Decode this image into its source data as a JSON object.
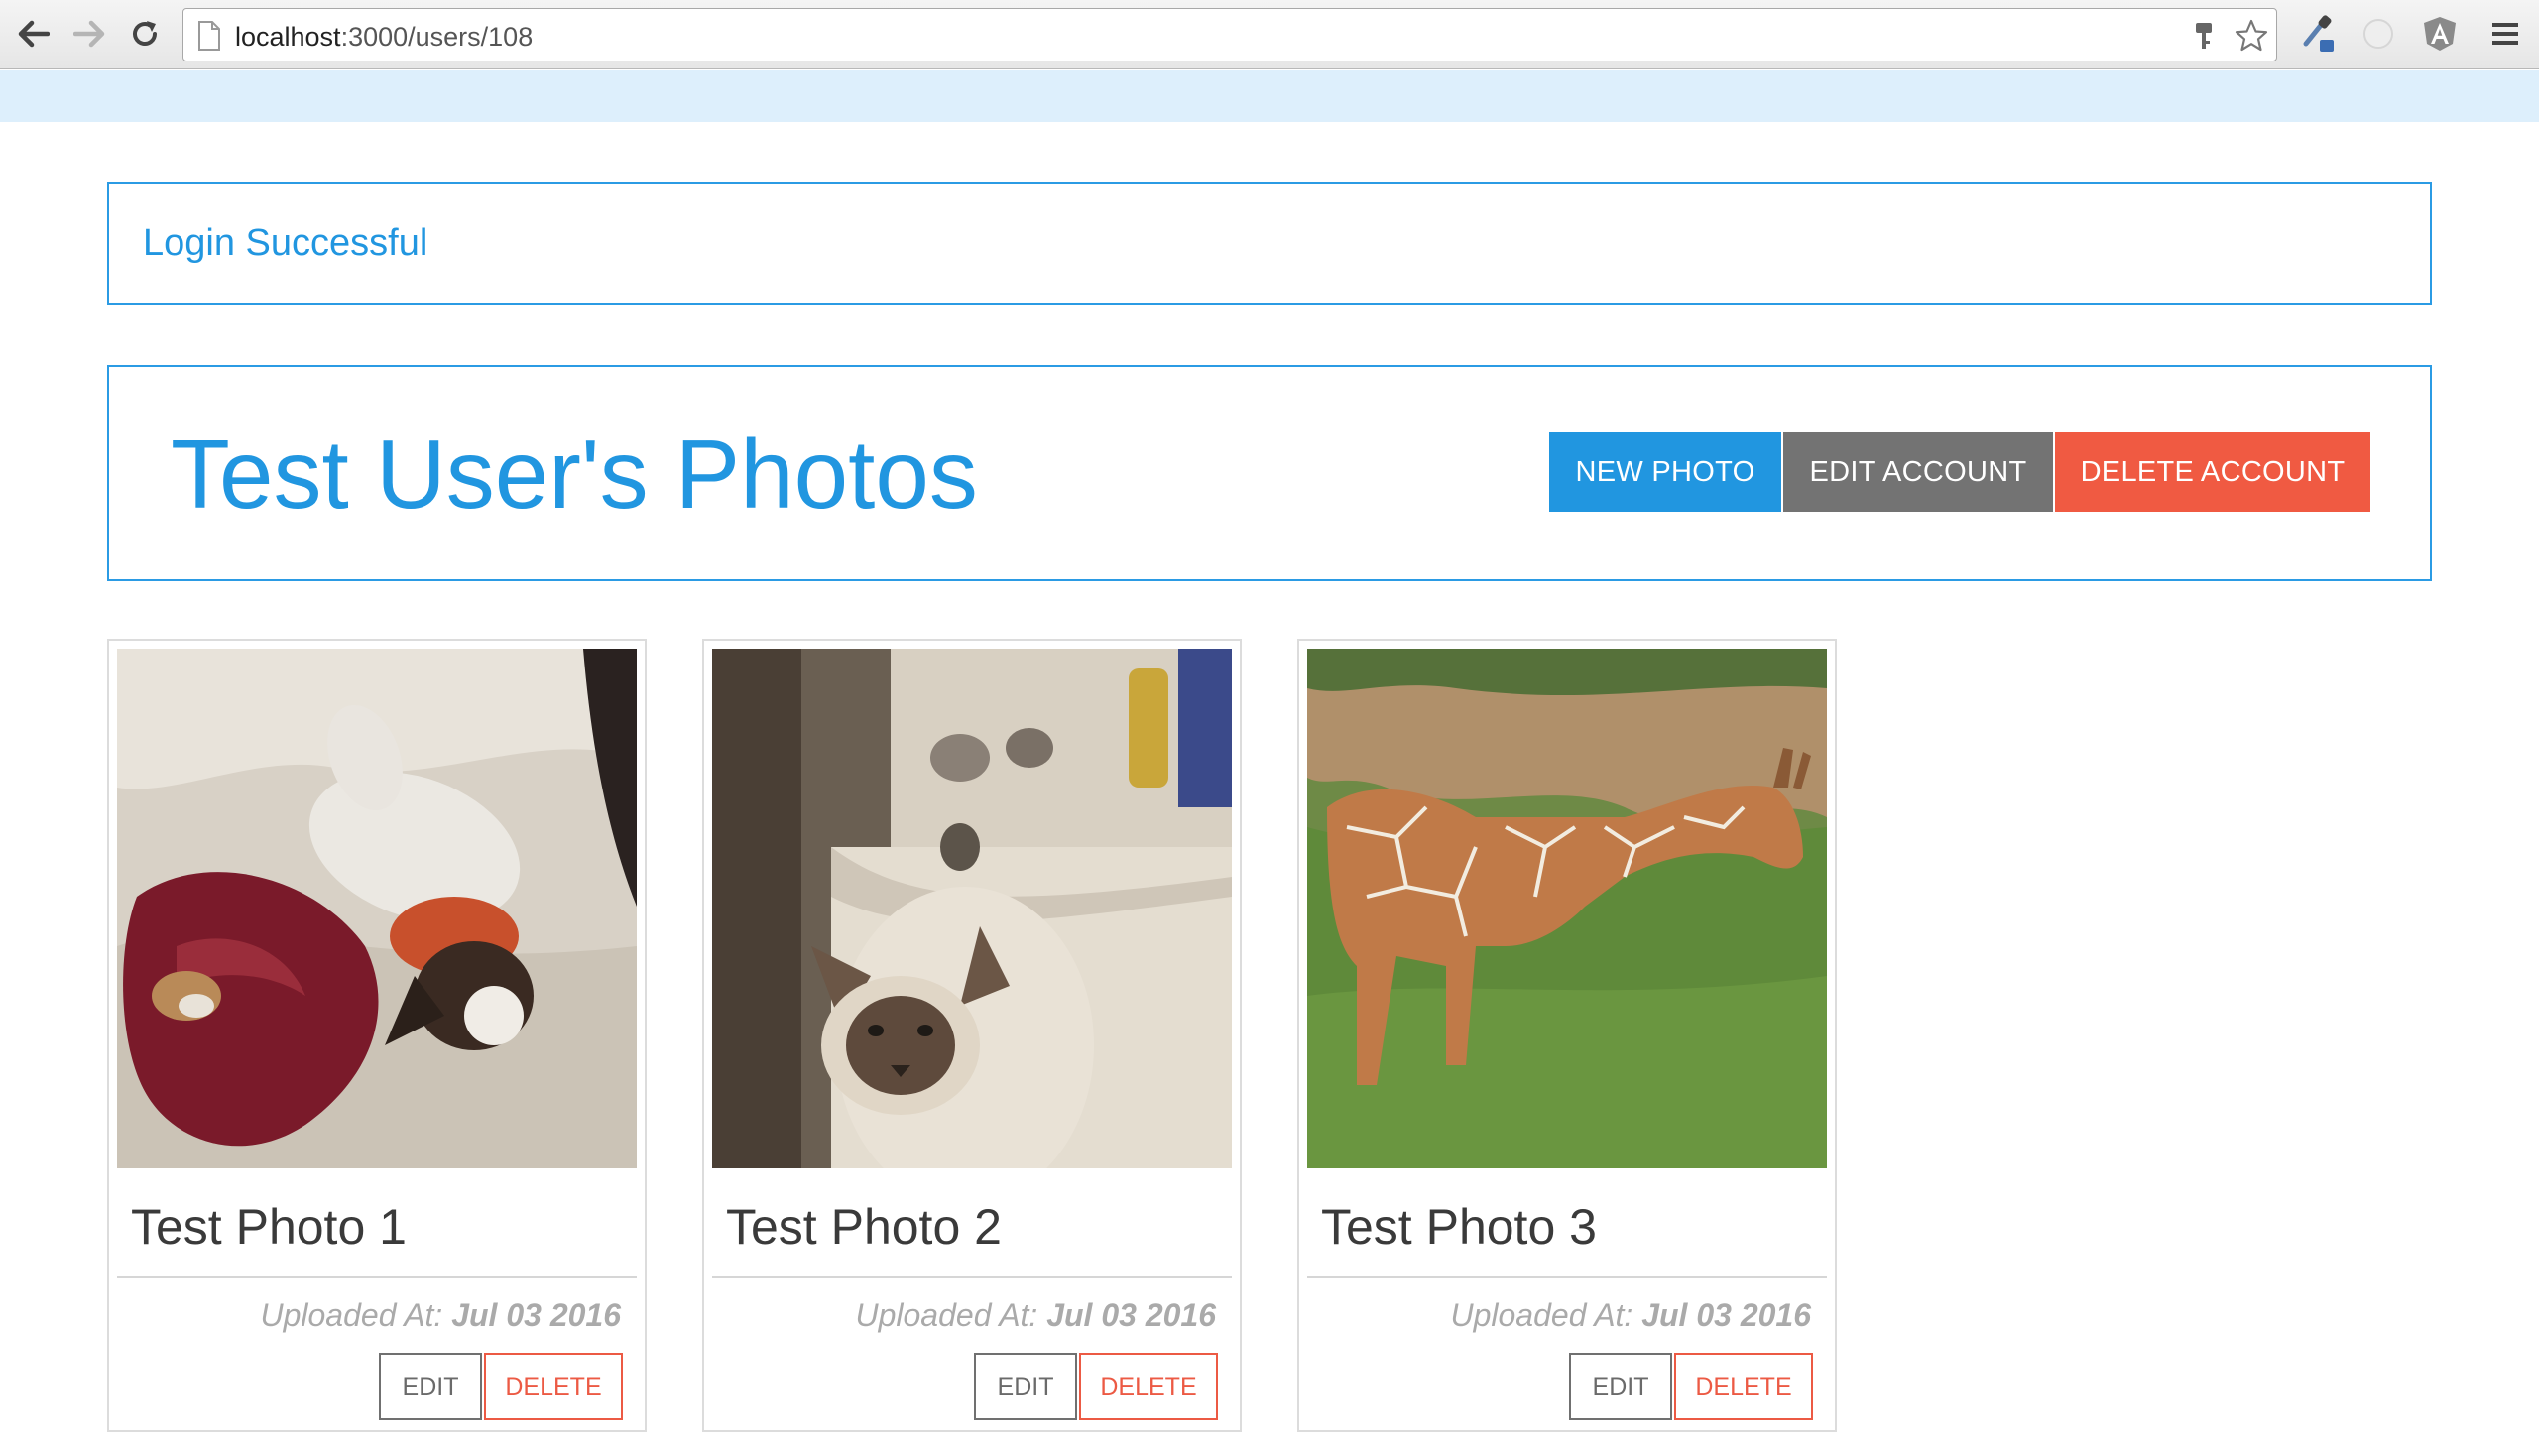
{
  "browser": {
    "url_host": "localhost",
    "url_path": ":3000/users/108"
  },
  "flash": {
    "message": "Login Successful"
  },
  "header": {
    "title": "Test User's Photos",
    "new_photo_label": "NEW PHOTO",
    "edit_account_label": "EDIT ACCOUNT",
    "delete_account_label": "DELETE ACCOUNT"
  },
  "photos": [
    {
      "title": "Test Photo 1",
      "uploaded_prefix": "Uploaded At:",
      "uploaded_date": "Jul 03 2016",
      "edit_label": "EDIT",
      "delete_label": "DELETE"
    },
    {
      "title": "Test Photo 2",
      "uploaded_prefix": "Uploaded At:",
      "uploaded_date": "Jul 03 2016",
      "edit_label": "EDIT",
      "delete_label": "DELETE"
    },
    {
      "title": "Test Photo 3",
      "uploaded_prefix": "Uploaded At:",
      "uploaded_date": "Jul 03 2016",
      "edit_label": "EDIT",
      "delete_label": "DELETE"
    }
  ],
  "colors": {
    "primary": "#2196e0",
    "secondary": "#737373",
    "danger": "#f05a42",
    "topbar": "#ddeffc"
  },
  "icons": [
    "back-arrow-icon",
    "forward-arrow-icon",
    "reload-icon",
    "page-icon",
    "key-icon",
    "star-icon",
    "eyedropper-icon",
    "extension-icon",
    "angular-icon",
    "menu-icon"
  ]
}
